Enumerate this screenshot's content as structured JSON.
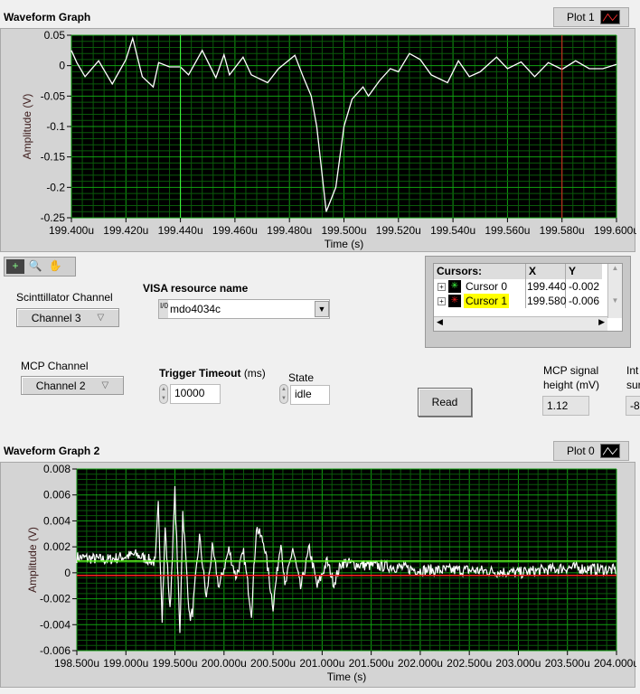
{
  "graph1": {
    "title": "Waveform Graph",
    "plot_label": "Plot 1",
    "plot_color": "#ff3030"
  },
  "graph2": {
    "title": "Waveform Graph 2",
    "plot_label": "Plot 0",
    "plot_color": "#ffffff"
  },
  "palette": {
    "tools": [
      "cursor-tool",
      "zoom-tool",
      "pan-tool"
    ]
  },
  "controls": {
    "scint_label": "Scinttillator Channel",
    "scint_value": "Channel 3",
    "mcp_label": "MCP Channel",
    "mcp_value": "Channel 2",
    "visa_label": "VISA resource name",
    "visa_value": "mdo4034c",
    "visa_prefix": "I/0",
    "trigger_label": "Trigger Timeout",
    "trigger_unit": "(ms)",
    "trigger_value": "10000",
    "state_label": "State",
    "state_value": "idle",
    "read_label": "Read",
    "mcp_height_label_1": "MCP signal",
    "mcp_height_label_2": "height (mV)",
    "mcp_height_value": "1.12",
    "int_label_1": "Int",
    "int_label_2": "sur",
    "int_value": "-8"
  },
  "cursors": {
    "headers": [
      "Cursors:",
      "X",
      "Y"
    ],
    "rows": [
      {
        "name": "Cursor 0",
        "x": "199.440",
        "y": "-0.002",
        "color": "#40ff40"
      },
      {
        "name": "Cursor 1",
        "x": "199.580",
        "y": "-0.006",
        "color": "#ff2020"
      }
    ]
  },
  "chart_data": [
    {
      "type": "line",
      "title": "Waveform Graph",
      "xlabel": "Time (s)",
      "ylabel": "Amplitude (V)",
      "xlim": [
        199.4,
        199.6
      ],
      "ylim": [
        -0.25,
        0.05
      ],
      "grid": true,
      "xticks": [
        "199.400u",
        "199.420u",
        "199.440u",
        "199.460u",
        "199.480u",
        "199.500u",
        "199.520u",
        "199.540u",
        "199.560u",
        "199.580u",
        "199.600u"
      ],
      "yticks": [
        "0.05",
        "0",
        "-0.05",
        "-0.1",
        "-0.15",
        "-0.2",
        "-0.25"
      ],
      "cursors_x": [
        199.44,
        199.58
      ],
      "x": [
        199.4,
        199.402,
        199.405,
        199.41,
        199.415,
        199.42,
        199.4225,
        199.426,
        199.43,
        199.432,
        199.436,
        199.44,
        199.443,
        199.448,
        199.453,
        199.456,
        199.458,
        199.463,
        199.466,
        199.472,
        199.476,
        199.482,
        199.485,
        199.488,
        199.49,
        199.4935,
        199.497,
        199.5,
        199.503,
        199.507,
        199.509,
        199.513,
        199.517,
        199.52,
        199.524,
        199.528,
        199.532,
        199.538,
        199.542,
        199.546,
        199.55,
        199.556,
        199.56,
        199.565,
        199.57,
        199.575,
        199.58,
        199.585,
        199.59,
        199.595,
        199.6
      ],
      "y": [
        0.025,
        0.005,
        -0.018,
        0.008,
        -0.03,
        0.01,
        0.045,
        -0.018,
        -0.035,
        0.005,
        -0.002,
        -0.002,
        -0.015,
        0.025,
        -0.02,
        0.018,
        -0.015,
        0.014,
        -0.015,
        -0.028,
        -0.005,
        0.017,
        -0.018,
        -0.05,
        -0.1,
        -0.24,
        -0.2,
        -0.1,
        -0.055,
        -0.035,
        -0.05,
        -0.025,
        -0.005,
        -0.01,
        0.02,
        0.01,
        -0.015,
        -0.028,
        0.008,
        -0.018,
        -0.01,
        0.014,
        -0.005,
        0.006,
        -0.018,
        0.005,
        -0.006,
        0.008,
        -0.005,
        -0.005,
        0.002
      ]
    },
    {
      "type": "line",
      "title": "Waveform Graph 2",
      "xlabel": "Time (s)",
      "ylabel": "Amplitude (V)",
      "xlim": [
        198.5,
        204.0
      ],
      "ylim": [
        -0.006,
        0.008
      ],
      "grid": true,
      "xticks": [
        "198.500u",
        "199.000u",
        "199.500u",
        "200.000u",
        "200.500u",
        "201.000u",
        "201.500u",
        "202.000u",
        "202.500u",
        "203.000u",
        "203.500u",
        "204.000u"
      ],
      "yticks": [
        "0.008",
        "0.006",
        "0.004",
        "0.002",
        "0",
        "-0.002",
        "-0.004",
        "-0.006"
      ],
      "cursors_y": [
        0.0009,
        -0.0002
      ],
      "x": [
        198.5,
        198.8,
        199.1,
        199.3,
        199.33,
        199.37,
        199.4,
        199.45,
        199.5,
        199.55,
        199.58,
        199.65,
        199.68,
        199.75,
        199.82,
        199.88,
        199.95,
        200.05,
        200.12,
        200.2,
        200.28,
        200.33,
        200.41,
        200.5,
        200.58,
        200.62,
        200.7,
        200.78,
        200.87,
        200.95,
        201.05,
        201.12,
        201.2,
        201.4,
        201.7,
        202.0,
        202.5,
        203.0,
        203.5,
        204.0
      ],
      "y": [
        0.0012,
        0.001,
        0.0014,
        0.0008,
        0.0053,
        -0.0034,
        0.0035,
        -0.003,
        0.0063,
        -0.0048,
        0.0047,
        -0.0035,
        -0.003,
        0.0028,
        -0.002,
        0.0019,
        -0.0011,
        0.0018,
        -0.0003,
        0.0015,
        -0.0031,
        0.0035,
        0.0022,
        -0.0026,
        0.0026,
        -0.0012,
        0.0019,
        -0.0012,
        0.0019,
        -0.0011,
        0.0009,
        -0.0008,
        0.0008,
        0.0006,
        0.0005,
        0.0002,
        0.0002,
        0.0,
        0.0004,
        0.0002
      ]
    }
  ]
}
